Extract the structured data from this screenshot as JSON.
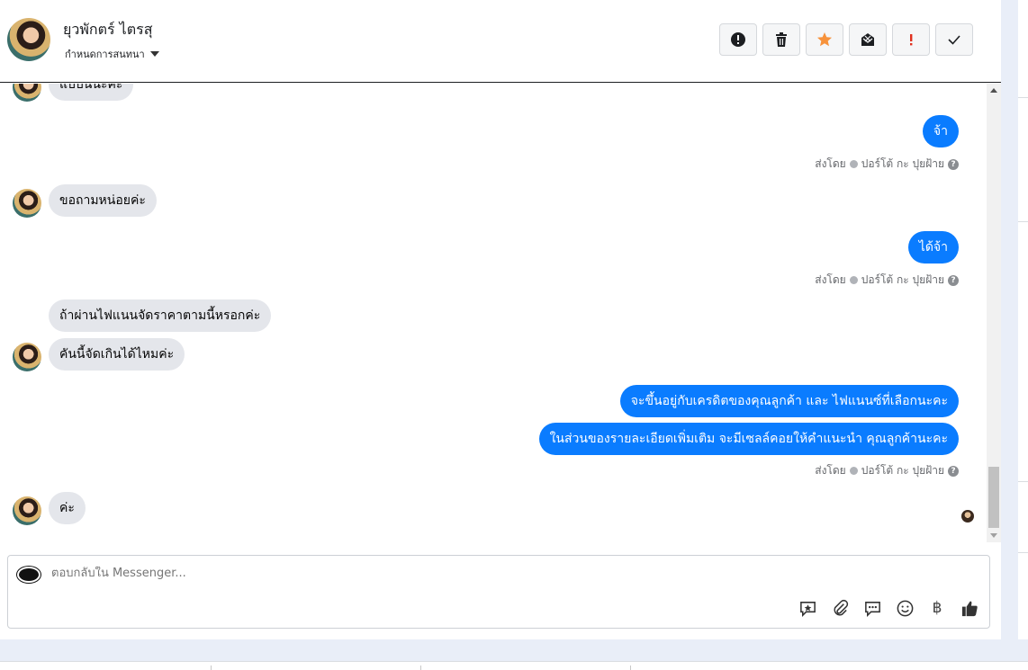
{
  "header": {
    "contact_name": "ยุวพักตร์ ไตรสุ",
    "conversation_setting": "กำหนดการสนทนา"
  },
  "toolbar": {
    "buttons": [
      {
        "name": "spam-button",
        "icon": "exclamation-circle-icon"
      },
      {
        "name": "delete-button",
        "icon": "trash-icon"
      },
      {
        "name": "star-button",
        "icon": "star-icon",
        "color": "#f7923b"
      },
      {
        "name": "mark-unread-button",
        "icon": "envelope-icon"
      },
      {
        "name": "follow-up-button",
        "icon": "exclamation-icon",
        "color": "#e0301e"
      },
      {
        "name": "done-button",
        "icon": "check-icon"
      }
    ]
  },
  "messages": {
    "m1": "แบบนี้นะคะ",
    "m2": "จ้า",
    "m3": "ขอถามหน่อยค่ะ",
    "m4": "ได้จ้า",
    "m5": "ถ้าผ่านไฟแนนจัดราคาตามนี้หรอกค่ะ",
    "m6": "คันนี้จัดเกินได้ไหมค่ะ",
    "m7": "จะขึ้นอยู่กับเครดิตของคุณลูกค้า และ ไฟแนนซ์ที่เลือกนะคะ",
    "m8": "ในส่วนของรายละเอียดเพิ่มเติม จะมีเซลล์คอยให้คำแนะนำ คุณลูกค้านะคะ",
    "m9": "ค่ะ"
  },
  "sent_by": {
    "prefix": "ส่งโดย",
    "agent": "ปอร์โต้ กะ ปุยฝ้าย"
  },
  "composer": {
    "placeholder": "ตอบกลับใน Messenger...",
    "currency_symbol": "฿"
  },
  "colors": {
    "outgoing_bubble": "#0a7cff",
    "incoming_bubble": "#e4e6eb"
  }
}
